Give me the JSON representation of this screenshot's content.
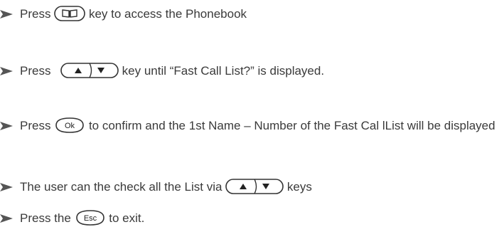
{
  "colors": {
    "text": "#3a3a3a",
    "arrow": "#555555"
  },
  "steps": [
    {
      "pre": "Press",
      "key": "phonebook-key-icon",
      "post": "key to access the Phonebook"
    },
    {
      "pre": "Press",
      "key": "up-down-keys-icon",
      "post": "key until “Fast Call List?” is displayed."
    },
    {
      "pre": "Press",
      "key": "ok-key-icon",
      "key_label": "Ok",
      "post": "to confirm and the 1st Name – Number of the Fast Cal lList will be displayed"
    },
    {
      "pre": "The user can the check all the List via",
      "key": "up-down-keys-icon",
      "post": "keys"
    },
    {
      "pre": "Press the",
      "key": "esc-key-icon",
      "key_label": "Esc",
      "post": "to exit."
    }
  ]
}
